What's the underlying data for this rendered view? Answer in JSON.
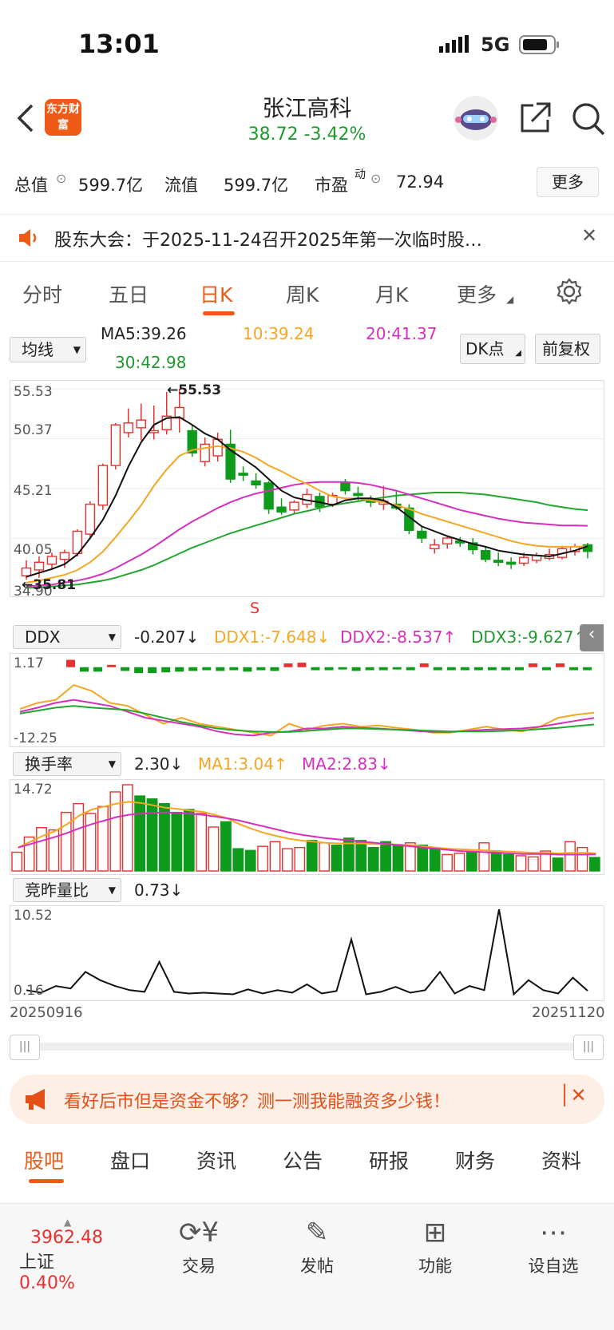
{
  "status_bar": {
    "time": "13:01",
    "network": "5G"
  },
  "header": {
    "logo_text": "东方财富",
    "stock_name": "张江高科",
    "price_line": "38.72  -3.42%"
  },
  "stats": {
    "total_value_label": "总值",
    "total_value": "599.7亿",
    "float_value_label": "流值",
    "float_value": "599.7亿",
    "pe_label": "市盈",
    "pe_sup": "动",
    "pe_value": "72.94",
    "more_button": "更多"
  },
  "notice": {
    "text": "股东大会：于2025-11-24召开2025年第一次临时股…"
  },
  "period_tabs": [
    {
      "label": "分时",
      "active": false
    },
    {
      "label": "五日",
      "active": false
    },
    {
      "label": "日K",
      "active": true
    },
    {
      "label": "周K",
      "active": false
    },
    {
      "label": "月K",
      "active": false
    },
    {
      "label": "更多",
      "active": false
    }
  ],
  "main_chart": {
    "indicator_select": "均线",
    "ma5": "MA5:39.26",
    "ma10": "10:39.24",
    "ma20": "20:41.37",
    "ma30": "30:42.98",
    "dk_button": "DK点",
    "adjust_button": "前复权",
    "y_labels": [
      "55.53",
      "50.37",
      "45.21",
      "40.05",
      "34.90"
    ],
    "high_marker": "55.53",
    "low_marker": "35.81",
    "s_marker": "S"
  },
  "ddx_panel": {
    "select": "DDX",
    "value": "-0.207",
    "ddx1": "DDX1:-7.648",
    "ddx2": "DDX2:-8.537",
    "ddx3": "DDX3:-9.627",
    "y_top": "1.17",
    "y_bottom": "-12.25"
  },
  "turnover_panel": {
    "select": "换手率",
    "value": "2.30",
    "ma1": "MA1:3.04",
    "ma2": "MA2:2.83",
    "y_top": "14.72"
  },
  "auction_panel": {
    "select": "竞昨量比",
    "value": "0.73",
    "y_top": "10.52",
    "y_bottom": "0.16"
  },
  "date_range": {
    "start": "20250916",
    "end": "20251120"
  },
  "banner": {
    "text": "看好后市但是资金不够？测一测我能融资多少钱！"
  },
  "bottom_tabs": [
    {
      "label": "股吧",
      "active": true
    },
    {
      "label": "盘口",
      "active": false
    },
    {
      "label": "资讯",
      "active": false
    },
    {
      "label": "公告",
      "active": false
    },
    {
      "label": "研报",
      "active": false
    },
    {
      "label": "财务",
      "active": false
    },
    {
      "label": "资料",
      "active": false
    }
  ],
  "dock": {
    "index_value": "3962.48",
    "index_name": "上证",
    "index_change": "0.40%",
    "trade": "交易",
    "post": "发帖",
    "functions": "功能",
    "watchlist": "设自选"
  },
  "colors": {
    "up": "#e8312f",
    "down": "#0e9a1a",
    "accent": "#ef5a16",
    "ma10": "#f5a623",
    "ma20": "#d62fbe",
    "ma30": "#22a62e"
  },
  "chart_data": [
    {
      "type": "candlestick",
      "title": "日K",
      "ylim": [
        34.9,
        55.53
      ],
      "candles": [
        {
          "o": 36.2,
          "h": 37.8,
          "l": 35.81,
          "c": 37.0
        },
        {
          "o": 36.8,
          "h": 38.2,
          "l": 36.0,
          "c": 37.6
        },
        {
          "o": 37.4,
          "h": 38.6,
          "l": 36.8,
          "c": 38.2
        },
        {
          "o": 37.9,
          "h": 38.9,
          "l": 37.0,
          "c": 38.6
        },
        {
          "o": 38.5,
          "h": 41.0,
          "l": 38.2,
          "c": 40.8
        },
        {
          "o": 40.5,
          "h": 43.9,
          "l": 40.0,
          "c": 43.6
        },
        {
          "o": 43.5,
          "h": 47.8,
          "l": 43.0,
          "c": 47.6
        },
        {
          "o": 47.6,
          "h": 52.0,
          "l": 47.2,
          "c": 51.8
        },
        {
          "o": 51.0,
          "h": 53.5,
          "l": 50.5,
          "c": 52.0
        },
        {
          "o": 51.5,
          "h": 54.0,
          "l": 50.2,
          "c": 52.3
        },
        {
          "o": 51.0,
          "h": 53.8,
          "l": 50.3,
          "c": 51.2
        },
        {
          "o": 51.3,
          "h": 55.2,
          "l": 50.8,
          "c": 52.7
        },
        {
          "o": 52.5,
          "h": 55.53,
          "l": 51.0,
          "c": 53.6
        },
        {
          "o": 51.2,
          "h": 51.8,
          "l": 48.5,
          "c": 48.9
        },
        {
          "o": 48.0,
          "h": 50.5,
          "l": 47.5,
          "c": 49.8
        },
        {
          "o": 48.6,
          "h": 51.0,
          "l": 48.0,
          "c": 50.3
        },
        {
          "o": 49.8,
          "h": 51.3,
          "l": 45.8,
          "c": 46.2
        },
        {
          "o": 46.8,
          "h": 47.5,
          "l": 46.0,
          "c": 46.6
        },
        {
          "o": 46.0,
          "h": 46.8,
          "l": 45.2,
          "c": 45.6
        },
        {
          "o": 45.8,
          "h": 46.0,
          "l": 42.6,
          "c": 43.1
        },
        {
          "o": 43.3,
          "h": 44.2,
          "l": 42.5,
          "c": 42.8
        },
        {
          "o": 43.0,
          "h": 44.0,
          "l": 42.6,
          "c": 43.8
        },
        {
          "o": 43.6,
          "h": 45.2,
          "l": 43.2,
          "c": 44.6
        },
        {
          "o": 44.4,
          "h": 44.8,
          "l": 42.8,
          "c": 43.3
        },
        {
          "o": 43.6,
          "h": 44.8,
          "l": 43.3,
          "c": 44.5
        },
        {
          "o": 45.8,
          "h": 46.2,
          "l": 44.6,
          "c": 45.0
        },
        {
          "o": 44.7,
          "h": 45.4,
          "l": 44.0,
          "c": 44.5
        },
        {
          "o": 44.0,
          "h": 44.5,
          "l": 43.3,
          "c": 43.8
        },
        {
          "o": 43.6,
          "h": 45.5,
          "l": 43.0,
          "c": 43.9
        },
        {
          "o": 43.6,
          "h": 45.0,
          "l": 43.0,
          "c": 43.2
        },
        {
          "o": 43.2,
          "h": 43.6,
          "l": 40.5,
          "c": 40.9
        },
        {
          "o": 40.8,
          "h": 41.3,
          "l": 39.6,
          "c": 40.1
        },
        {
          "o": 39.0,
          "h": 40.0,
          "l": 38.5,
          "c": 39.4
        },
        {
          "o": 39.5,
          "h": 40.4,
          "l": 39.0,
          "c": 40.1
        },
        {
          "o": 39.8,
          "h": 40.2,
          "l": 39.2,
          "c": 39.6
        },
        {
          "o": 39.6,
          "h": 40.1,
          "l": 38.4,
          "c": 38.9
        },
        {
          "o": 38.8,
          "h": 39.2,
          "l": 37.6,
          "c": 37.9
        },
        {
          "o": 37.8,
          "h": 38.6,
          "l": 37.2,
          "c": 37.6
        },
        {
          "o": 37.6,
          "h": 38.1,
          "l": 36.9,
          "c": 37.4
        },
        {
          "o": 37.5,
          "h": 38.6,
          "l": 37.2,
          "c": 38.1
        },
        {
          "o": 37.8,
          "h": 38.6,
          "l": 37.5,
          "c": 38.3
        },
        {
          "o": 38.0,
          "h": 39.0,
          "l": 37.8,
          "c": 38.4
        },
        {
          "o": 38.1,
          "h": 39.3,
          "l": 37.9,
          "c": 39.0
        },
        {
          "o": 38.7,
          "h": 39.5,
          "l": 38.3,
          "c": 39.2
        },
        {
          "o": 39.4,
          "h": 39.6,
          "l": 38.0,
          "c": 38.72
        }
      ],
      "ma5": [
        36.1,
        36.5,
        36.9,
        37.4,
        38.4,
        40.1,
        42.0,
        44.5,
        47.5,
        50.0,
        51.8,
        52.5,
        52.6,
        51.8,
        50.9,
        50.3,
        49.2,
        48.3,
        47.4,
        46.2,
        45.0,
        44.3,
        44.0,
        43.8,
        43.5,
        44.0,
        44.2,
        44.2,
        44.0,
        43.3,
        42.3,
        41.3,
        40.8,
        40.3,
        39.9,
        39.5,
        39.2,
        38.8,
        38.6,
        38.4,
        38.3,
        38.2,
        38.5,
        38.8,
        39.26
      ],
      "ma10": [
        35.5,
        35.7,
        36.0,
        36.3,
        36.8,
        37.6,
        38.7,
        40.2,
        41.8,
        43.5,
        45.5,
        47.2,
        48.6,
        49.2,
        49.4,
        49.6,
        49.4,
        49.0,
        48.4,
        47.6,
        47.0,
        46.3,
        45.7,
        45.0,
        44.4,
        44.2,
        44.2,
        44.0,
        43.8,
        43.5,
        43.1,
        42.6,
        42.2,
        41.8,
        41.4,
        41.0,
        40.6,
        40.2,
        39.8,
        39.5,
        39.3,
        39.2,
        39.2,
        39.2,
        39.24
      ],
      "ma20": [
        35.1,
        35.2,
        35.3,
        35.5,
        35.7,
        36.0,
        36.4,
        37.0,
        37.7,
        38.4,
        39.2,
        40.1,
        41.0,
        41.8,
        42.5,
        43.2,
        43.8,
        44.3,
        44.7,
        45.0,
        45.3,
        45.6,
        45.8,
        45.9,
        45.9,
        45.9,
        45.8,
        45.6,
        45.3,
        45.0,
        44.6,
        44.2,
        43.8,
        43.4,
        43.0,
        42.7,
        42.4,
        42.1,
        41.9,
        41.7,
        41.6,
        41.5,
        41.4,
        41.4,
        41.37
      ],
      "ma30": [
        34.95,
        35.0,
        35.1,
        35.2,
        35.3,
        35.5,
        35.7,
        36.0,
        36.4,
        36.8,
        37.3,
        37.9,
        38.5,
        39.1,
        39.6,
        40.1,
        40.6,
        41.0,
        41.4,
        41.8,
        42.2,
        42.6,
        42.9,
        43.2,
        43.5,
        43.7,
        43.9,
        44.1,
        44.3,
        44.5,
        44.6,
        44.7,
        44.8,
        44.8,
        44.8,
        44.7,
        44.6,
        44.4,
        44.2,
        44.0,
        43.8,
        43.5,
        43.3,
        43.1,
        42.98
      ]
    },
    {
      "type": "bar",
      "title": "换手率",
      "ylim": [
        0,
        14.72
      ],
      "values": [
        3.2,
        5.8,
        7.4,
        7.0,
        10.0,
        11.5,
        9.8,
        11.0,
        13.5,
        14.72,
        12.8,
        12.3,
        11.5,
        10.0,
        10.5,
        9.8,
        7.5,
        8.4,
        3.8,
        3.5,
        4.2,
        5.0,
        3.8,
        4.0,
        5.2,
        4.8,
        4.4,
        5.6,
        5.2,
        4.0,
        5.0,
        4.5,
        4.8,
        4.4,
        3.8,
        2.8,
        3.0,
        3.2,
        4.8,
        3.4,
        2.8,
        2.6,
        2.4,
        3.4,
        2.2,
        5.0,
        4.0,
        2.3
      ],
      "ma1": [
        4.0,
        5.0,
        6.0,
        6.8,
        8.0,
        9.5,
        10.5,
        11.0,
        11.5,
        11.8,
        11.6,
        11.2,
        10.8,
        10.6,
        10.3,
        10.1,
        9.6,
        9.0,
        8.0,
        7.2,
        6.5,
        6.0,
        5.5,
        5.2,
        5.0,
        4.8,
        4.7,
        4.7,
        4.7,
        4.6,
        4.6,
        4.5,
        4.4,
        4.2,
        4.0,
        3.8,
        3.7,
        3.6,
        3.5,
        3.4,
        3.3,
        3.2,
        3.1,
        3.1,
        3.0,
        3.1,
        3.1,
        3.04
      ],
      "ma2": [
        4.0,
        4.6,
        5.2,
        5.8,
        6.5,
        7.3,
        8.0,
        8.6,
        9.2,
        9.6,
        9.8,
        9.9,
        10.0,
        9.9,
        9.8,
        9.6,
        9.3,
        9.0,
        8.6,
        8.1,
        7.6,
        7.1,
        6.6,
        6.2,
        5.9,
        5.6,
        5.4,
        5.2,
        5.0,
        4.8,
        4.6,
        4.4,
        4.2,
        4.0,
        3.8,
        3.6,
        3.4,
        3.3,
        3.2,
        3.1,
        3.0,
        2.9,
        2.9,
        2.9,
        2.8,
        2.8,
        2.8,
        2.83
      ]
    },
    {
      "type": "line",
      "title": "竞昨量比",
      "ylim": [
        0.16,
        10.52
      ],
      "values": [
        0.8,
        0.5,
        1.3,
        1.0,
        3.0,
        2.0,
        1.3,
        0.8,
        0.6,
        4.2,
        0.6,
        0.4,
        0.5,
        0.4,
        0.3,
        0.9,
        0.4,
        0.8,
        0.5,
        1.5,
        0.4,
        0.7,
        6.9,
        0.3,
        0.6,
        1.2,
        0.5,
        0.8,
        3.0,
        0.4,
        1.3,
        0.8,
        10.52,
        0.3,
        2.0,
        0.8,
        0.4,
        2.3,
        0.73
      ]
    },
    {
      "type": "line",
      "title": "DDX",
      "ylim": [
        -12.25,
        1.17
      ],
      "ddx1": [
        -7.0,
        -6.0,
        -5.5,
        -3.0,
        -4.0,
        -6.0,
        -6.5,
        -8.0,
        -9.5,
        -8.5,
        -9.5,
        -10.0,
        -10.5,
        -11.0,
        -11.5,
        -9.5,
        -10.5,
        -9.8,
        -9.5,
        -10.0,
        -9.8,
        -10.2,
        -10.5,
        -11.0,
        -11.0,
        -10.5,
        -10.0,
        -10.5,
        -10.8,
        -10.0,
        -8.5,
        -8.0,
        -7.648
      ],
      "ddx2": [
        -7.5,
        -6.8,
        -6.0,
        -5.5,
        -6.0,
        -6.5,
        -7.5,
        -8.5,
        -9.0,
        -9.5,
        -10.0,
        -10.8,
        -11.3,
        -11.5,
        -11.0,
        -10.8,
        -10.3,
        -10.3,
        -10.0,
        -10.2,
        -10.3,
        -10.5,
        -10.7,
        -10.9,
        -10.9,
        -10.7,
        -10.5,
        -10.4,
        -10.3,
        -10.0,
        -9.5,
        -9.0,
        -8.537
      ],
      "ddx3": [
        -7.8,
        -7.3,
        -6.8,
        -6.5,
        -6.8,
        -7.0,
        -7.2,
        -7.8,
        -8.5,
        -9.2,
        -9.8,
        -10.3,
        -10.6,
        -10.8,
        -10.9,
        -10.9,
        -10.7,
        -10.5,
        -10.3,
        -10.3,
        -10.4,
        -10.5,
        -10.6,
        -10.7,
        -10.8,
        -10.8,
        -10.8,
        -10.7,
        -10.6,
        -10.4,
        -10.2,
        -9.9,
        -9.627
      ]
    }
  ]
}
